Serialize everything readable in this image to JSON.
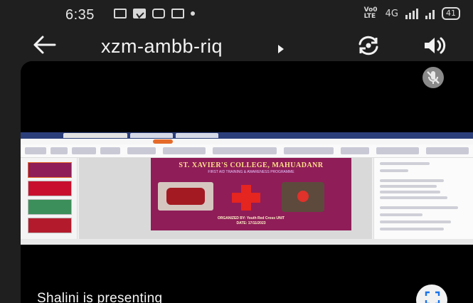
{
  "status_bar": {
    "time": "6:35",
    "network": "4G",
    "volte_label": "Vo0 LTE",
    "battery": "41"
  },
  "header": {
    "meeting_code": "xzm-ambb-riq"
  },
  "shared_slide": {
    "title": "ST. XAVIER'S COLLEGE, MAHUADANR",
    "subtitle": "FIRST AID TRAINING & AWARENESS PROGRAMME",
    "organizer": "ORGANIZED BY: Youth Red Cross UNIT",
    "date": "DATE: 17/11/2023"
  },
  "footer": {
    "presenter_text": "Shalini is presenting"
  },
  "colors": {
    "background": "#1f1f1f",
    "stage": "#000000",
    "slide_bg": "#8f1d58",
    "slide_title": "#ffe08a"
  },
  "icons": {
    "back": "arrow-left-icon",
    "switch_camera": "switch-camera-icon",
    "speaker": "speaker-icon",
    "mic_off": "mic-off-icon",
    "fullscreen": "fullscreen-icon"
  }
}
